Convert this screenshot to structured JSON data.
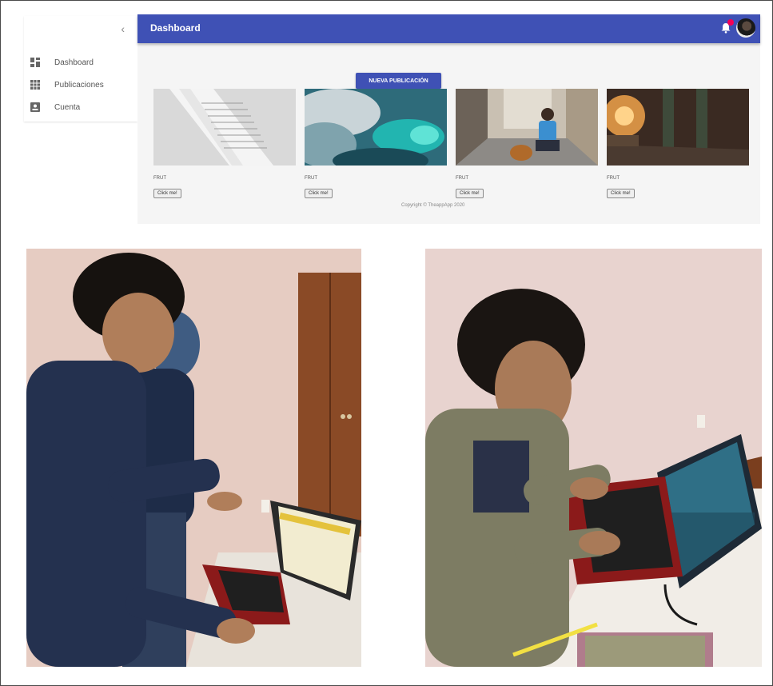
{
  "sidebar": {
    "collapse_icon": "chevron-left-icon",
    "items": [
      {
        "label": "Dashboard",
        "icon": "dashboard-icon"
      },
      {
        "label": "Publicaciones",
        "icon": "grid-icon"
      },
      {
        "label": "Cuenta",
        "icon": "account-box-icon"
      }
    ]
  },
  "header": {
    "title": "Dashboard",
    "notification_icon": "bell-icon",
    "accent_color": "#3f51b5",
    "badge_color": "#f50057"
  },
  "main": {
    "new_post_label": "NUEVA PUBLICACIÓN",
    "cards": [
      {
        "name": "FRUT",
        "button": "Click me!",
        "image": "papers-photo"
      },
      {
        "name": "FRUT",
        "button": "Click me!",
        "image": "aurora-clouds-photo"
      },
      {
        "name": "FRUT",
        "button": "Click me!",
        "image": "street-dog-photo"
      },
      {
        "name": "FRUT",
        "button": "Click me!",
        "image": "sunset-legs-photo"
      }
    ],
    "copyright": "Copyright © TheappApp 2020"
  },
  "photos": [
    {
      "subject": "two-people-at-laptop-photo"
    },
    {
      "subject": "man-typing-on-laptop-photo"
    }
  ]
}
